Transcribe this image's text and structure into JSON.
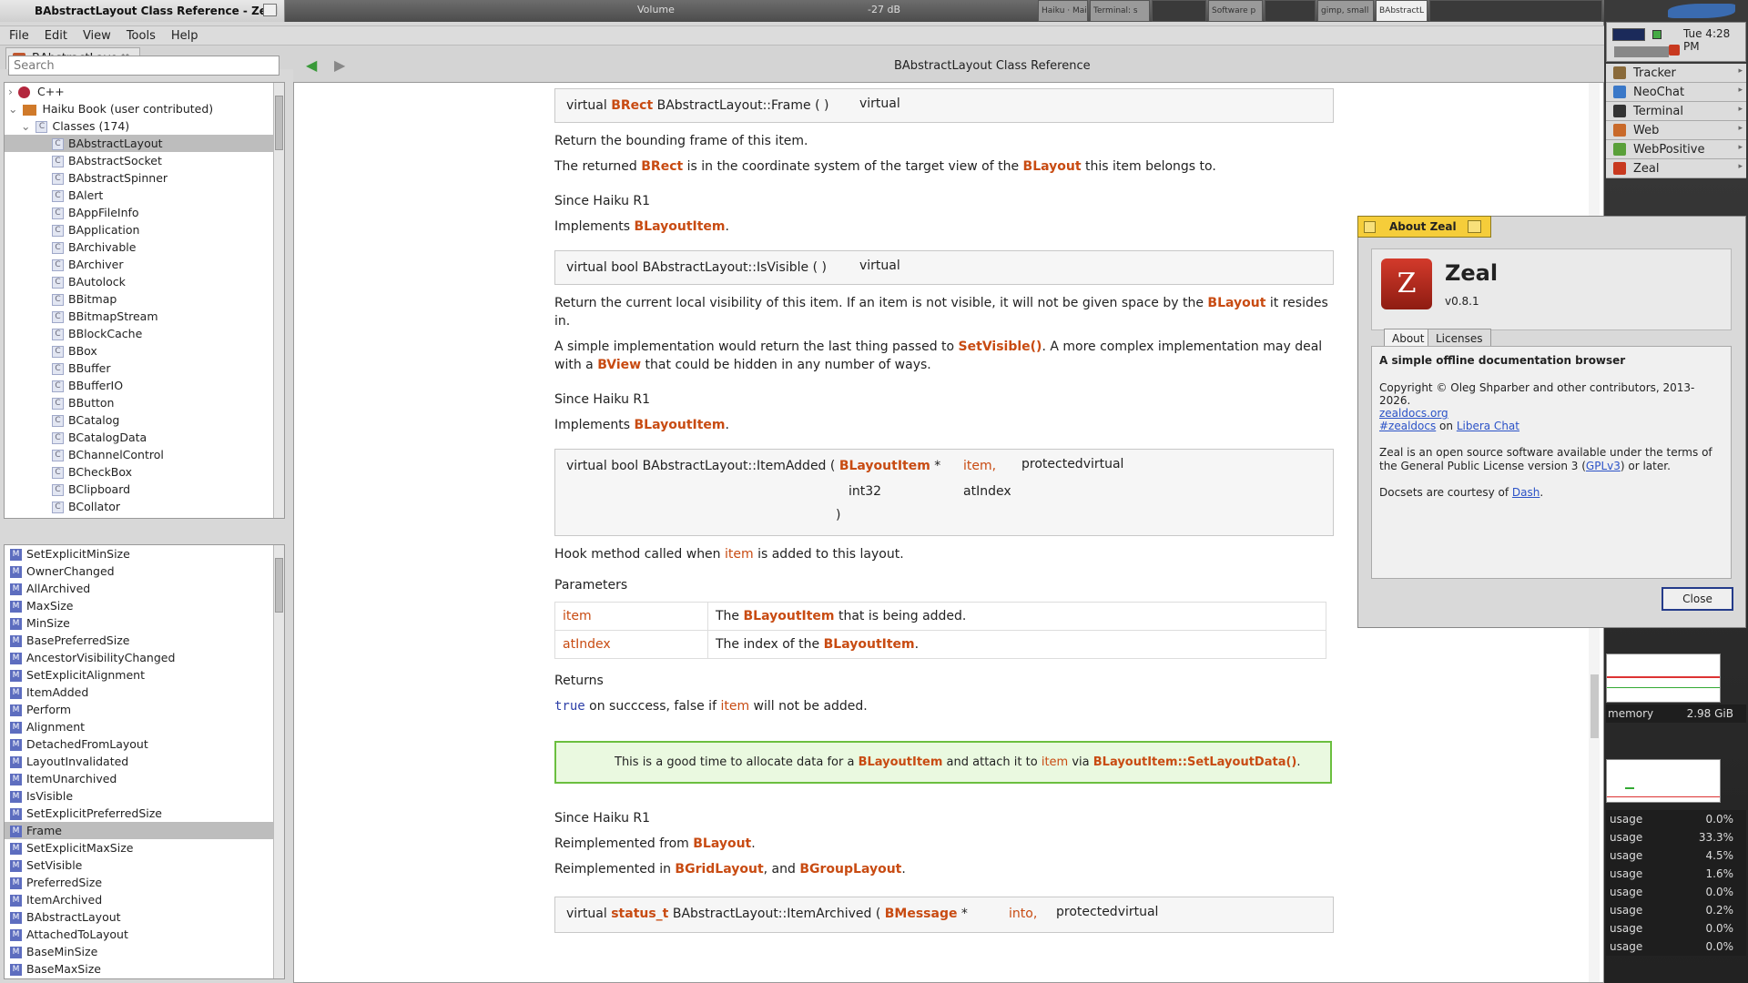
{
  "topbar": {
    "window_title": "BAbstractLayout Class Reference - Zeal",
    "volume_label": "Volume",
    "volume_db": "-27 dB",
    "tray_items": [
      "Haiku · Mai",
      "Terminal: s",
      "",
      "Software p",
      "",
      "gimp, small",
      "BAbstractL",
      ""
    ]
  },
  "menubar": [
    "File",
    "Edit",
    "View",
    "Tools",
    "Help"
  ],
  "tab": {
    "label": "BAbstractLayo...",
    "close": "✖"
  },
  "search": {
    "placeholder": "Search",
    "value": ""
  },
  "nav": {
    "title": "BAbstractLayout Class Reference",
    "back": "◀",
    "forward": "▶"
  },
  "tree": {
    "root_items": [
      {
        "label": "C++",
        "toggle": "›"
      },
      {
        "label": "Haiku Book (user contributed)",
        "toggle": "⌄"
      },
      {
        "label": "Classes (174)",
        "toggle": "⌄"
      }
    ],
    "classes": [
      "BAbstractLayout",
      "BAbstractSocket",
      "BAbstractSpinner",
      "BAlert",
      "BAppFileInfo",
      "BApplication",
      "BArchivable",
      "BArchiver",
      "BAutolock",
      "BBitmap",
      "BBitmapStream",
      "BBlockCache",
      "BBox",
      "BBuffer",
      "BBufferIO",
      "BButton",
      "BCatalog",
      "BCatalogData",
      "BChannelControl",
      "BCheckBox",
      "BClipboard",
      "BCollator"
    ],
    "selected": "BAbstractLayout"
  },
  "methods": {
    "items": [
      "SetExplicitMinSize",
      "OwnerChanged",
      "AllArchived",
      "MaxSize",
      "MinSize",
      "BasePreferredSize",
      "AncestorVisibilityChanged",
      "SetExplicitAlignment",
      "ItemAdded",
      "Perform",
      "Alignment",
      "DetachedFromLayout",
      "LayoutInvalidated",
      "ItemUnarchived",
      "IsVisible",
      "SetExplicitPreferredSize",
      "Frame",
      "SetExplicitMaxSize",
      "SetVisible",
      "PreferredSize",
      "ItemArchived",
      "BAbstractLayout",
      "AttachedToLayout",
      "BaseMinSize",
      "BaseMaxSize"
    ],
    "selected": "Frame"
  },
  "doc": {
    "frame_proto": {
      "pre": "virtual ",
      "type": "BRect",
      "name": " BAbstractLayout::Frame ( ) ",
      "tag": "virtual"
    },
    "frame_p1": "Return the bounding frame of this item.",
    "frame_p2": {
      "a": "The returned ",
      "b": "BRect",
      "c": " is in the coordinate system of the target view of the ",
      "d": "BLayout",
      "e": " this item belongs to."
    },
    "since": "Since  Haiku R1",
    "implements": "Implements ",
    "blayoutitem": "BLayoutItem",
    "dot": ".",
    "isvisible_proto": {
      "text": "virtual bool BAbstractLayout::IsVisible ( ) ",
      "tag": "virtual"
    },
    "isvisible_p1": {
      "a": "Return the current local visibility of this item. If an item is not visible, it will not be given space by the ",
      "b": "BLayout",
      "c": " it resides in."
    },
    "isvisible_p2": {
      "a": "A simple implementation would return the last thing passed to ",
      "b": "SetVisible()",
      "c": ". A more complex implementation may deal with a ",
      "d": "BView",
      "e": " that could be hidden in any number of ways."
    },
    "itemadded_proto": {
      "text": "virtual bool BAbstractLayout::ItemAdded ( ",
      "t1": "BLayoutItem",
      "star": " * ",
      "p1": "item,",
      "t2": "int32",
      "p2": "atIndex",
      "close": ")",
      "tag": "protectedvirtual"
    },
    "itemadded_p1": {
      "a": "Hook method called when ",
      "b": "item",
      "c": " is added to this layout."
    },
    "params_heading": "Parameters",
    "params": [
      {
        "name": "item",
        "a": "The ",
        "b": "BLayoutItem",
        "c": " that is being added."
      },
      {
        "name": "atIndex",
        "a": "The index of the ",
        "b": "BLayoutItem",
        "c": "."
      }
    ],
    "returns_heading": "Returns",
    "returns": {
      "code": "true",
      "a": " on succcess, false if ",
      "b": "item",
      "c": " will not be added."
    },
    "note": {
      "a": "This is a good time to allocate data for a ",
      "b": "BLayoutItem",
      "c": " and attach it to ",
      "d": "item",
      "e": " via ",
      "f": "BLayoutItem::SetLayoutData()",
      "g": "."
    },
    "reimpl_from": {
      "a": "Reimplemented from ",
      "b": "BLayout",
      "c": "."
    },
    "reimpl_in": {
      "a": "Reimplemented in ",
      "b": "BGridLayout",
      "c": ", and ",
      "d": "BGroupLayout",
      "e": "."
    },
    "archived_proto": {
      "pre": "virtual ",
      "type": "status_t",
      "name": " BAbstractLayout::ItemArchived ( ",
      "t1": "BMessage",
      "star": " * ",
      "p1": "into,",
      "tag": "protectedvirtual"
    }
  },
  "deskbar": {
    "time": "Tue 4:28 PM",
    "items": [
      {
        "label": "Tracker",
        "icon": "tracker-icon",
        "color": "#8a6a3a"
      },
      {
        "label": "NeoChat",
        "icon": "neochat-icon",
        "color": "#3a78c8"
      },
      {
        "label": "Terminal",
        "icon": "terminal-icon",
        "color": "#333333"
      },
      {
        "label": "Web",
        "icon": "web-icon",
        "color": "#c96a2a"
      },
      {
        "label": "WebPositive",
        "icon": "webpositive-icon",
        "color": "#5aa03a"
      },
      {
        "label": "Zeal",
        "icon": "zeal-icon",
        "color": "#c8391f"
      }
    ],
    "arrow": "▸"
  },
  "monitor": {
    "memory_label": "memory",
    "memory_value": "2.98 GiB",
    "usage_rows": [
      {
        "label": "usage",
        "value": "0.0%"
      },
      {
        "label": "usage",
        "value": "33.3%"
      },
      {
        "label": "usage",
        "value": "4.5%"
      },
      {
        "label": "usage",
        "value": "1.6%"
      },
      {
        "label": "usage",
        "value": "0.0%"
      },
      {
        "label": "usage",
        "value": "0.2%"
      },
      {
        "label": "usage",
        "value": "0.0%"
      },
      {
        "label": "usage",
        "value": "0.0%"
      }
    ]
  },
  "about": {
    "tab_title": "About Zeal",
    "app_name": "Zeal",
    "version": "v0.8.1",
    "logo_letter": "Z",
    "tabs": [
      "About",
      "Licenses"
    ],
    "tagline": "A simple offline documentation browser",
    "copyright": "Copyright © Oleg Shparber and other contributors, 2013-2026.",
    "website": "zealdocs.org",
    "irc": "#zealdocs",
    "irc_on": " on ",
    "irc_net": "Libera Chat",
    "license_a": "Zeal is an open source software available under the terms of the General Public License version 3 (",
    "license_link": "GPLv3",
    "license_b": ") or later.",
    "docsets_a": "Docsets are courtesy of ",
    "docsets_link": "Dash",
    "docsets_b": ".",
    "close_label": "Close"
  },
  "colors": {
    "accent": "#c84b12",
    "selection": "#bdbdbd",
    "note_border": "#6bbf3f",
    "note_bg": "#eaf9e0",
    "about_tab": "#f5cd3a"
  }
}
